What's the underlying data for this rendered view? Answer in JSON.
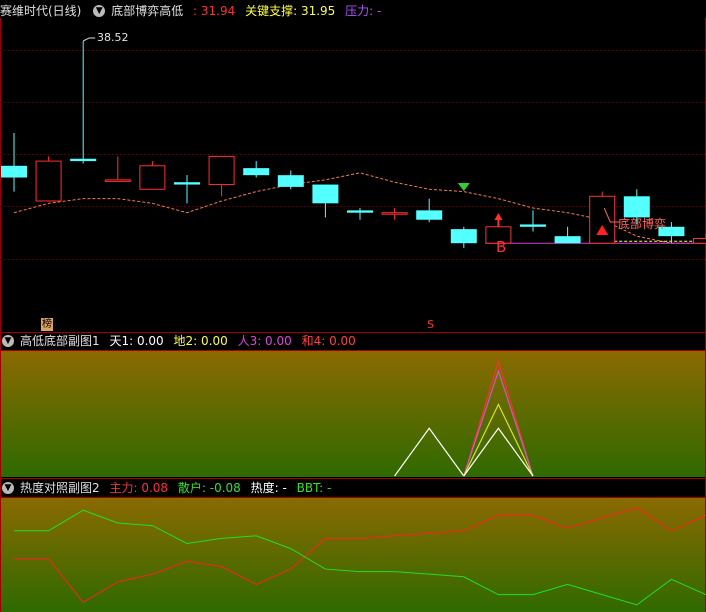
{
  "main_header": {
    "stock_name": "赛维时代(日线)",
    "indicator_name": "底部博弈高低",
    "value1": ": 31.94",
    "key_support_label": "关键支撑",
    "key_support_value": ": 31.95",
    "pressure_label": "压力",
    "pressure_value": ": -"
  },
  "sub1_header": {
    "name": "高低底部副图1",
    "tian": "天1: 0.00",
    "di": "地2: 0.00",
    "ren": "人3: 0.00",
    "he": "和4: 0.00"
  },
  "sub2_header": {
    "name": "热度对照副图2",
    "main_force": "主力: 0.08",
    "retail": "散户: -0.08",
    "heat": "热度: -",
    "bbt": "BBT: -"
  },
  "annotations": {
    "high_label": "38.52",
    "b_label": "B",
    "bottom_game_label": "底部博弈",
    "rank_marker": "榜",
    "s_marker": "S"
  },
  "colors": {
    "up": "#ff3030",
    "down": "#54ffff",
    "ma": "#ff7a3a",
    "support": "#d040d0",
    "main_force": "#ff2020",
    "retail": "#20e020"
  },
  "chart_data": [
    {
      "type": "candlestick",
      "title": "底部博弈高低",
      "candles": [
        {
          "o": 33.2,
          "h": 34.6,
          "l": 32.1,
          "c": 32.7,
          "dir": "down"
        },
        {
          "o": 31.7,
          "h": 33.6,
          "l": 31.7,
          "c": 33.4,
          "dir": "up"
        },
        {
          "o": 33.5,
          "h": 38.52,
          "l": 33.3,
          "c": 33.4,
          "dir": "down"
        },
        {
          "o": 32.6,
          "h": 33.6,
          "l": 32.6,
          "c": 32.6,
          "dir": "up"
        },
        {
          "o": 32.2,
          "h": 33.4,
          "l": 32.2,
          "c": 33.2,
          "dir": "up"
        },
        {
          "o": 32.5,
          "h": 32.8,
          "l": 31.6,
          "c": 32.4,
          "dir": "down"
        },
        {
          "o": 32.4,
          "h": 33.6,
          "l": 31.9,
          "c": 33.6,
          "dir": "up"
        },
        {
          "o": 33.1,
          "h": 33.4,
          "l": 32.7,
          "c": 32.8,
          "dir": "down"
        },
        {
          "o": 32.8,
          "h": 33.0,
          "l": 32.2,
          "c": 32.3,
          "dir": "down"
        },
        {
          "o": 32.4,
          "h": 32.4,
          "l": 31.0,
          "c": 31.6,
          "dir": "down"
        },
        {
          "o": 31.3,
          "h": 31.4,
          "l": 30.9,
          "c": 31.2,
          "dir": "down"
        },
        {
          "o": 31.2,
          "h": 31.4,
          "l": 30.9,
          "c": 31.2,
          "dir": "up"
        },
        {
          "o": 31.3,
          "h": 31.8,
          "l": 30.8,
          "c": 30.9,
          "dir": "down"
        },
        {
          "o": 30.5,
          "h": 30.6,
          "l": 29.7,
          "c": 29.9,
          "dir": "down"
        },
        {
          "o": 29.9,
          "h": 31.0,
          "l": 29.9,
          "c": 30.6,
          "dir": "up"
        },
        {
          "o": 30.7,
          "h": 31.3,
          "l": 30.4,
          "c": 30.6,
          "dir": "down"
        },
        {
          "o": 30.2,
          "h": 30.6,
          "l": 29.9,
          "c": 29.9,
          "dir": "down"
        },
        {
          "o": 29.9,
          "h": 32.1,
          "l": 29.9,
          "c": 31.9,
          "dir": "up"
        },
        {
          "o": 31.9,
          "h": 32.2,
          "l": 30.7,
          "c": 31.0,
          "dir": "down"
        },
        {
          "o": 30.6,
          "h": 30.8,
          "l": 29.9,
          "c": 30.2,
          "dir": "down"
        },
        {
          "o": 29.9,
          "h": 30.3,
          "l": 29.9,
          "c": 30.1,
          "dir": "up"
        }
      ],
      "ma": [
        31.2,
        31.6,
        31.8,
        31.8,
        31.6,
        31.2,
        31.7,
        32.1,
        32.4,
        32.6,
        32.9,
        32.5,
        32.2,
        32.1,
        31.8,
        31.4,
        31.2,
        30.9,
        30.2,
        29.9,
        29.9
      ],
      "ylim": [
        26.2,
        39.5
      ]
    },
    {
      "type": "area",
      "title": "高低底部副图1",
      "x": [
        11,
        12,
        13,
        14,
        15
      ],
      "series": [
        {
          "values": [
            0,
            1,
            0,
            null,
            null
          ],
          "color": "#ffffff"
        },
        {
          "values": [
            null,
            null,
            0,
            2.4,
            0
          ],
          "color": "#ff3030"
        },
        {
          "values": [
            null,
            null,
            0,
            2.2,
            0
          ],
          "color": "#c060c0"
        },
        {
          "values": [
            null,
            null,
            0,
            1.5,
            0
          ],
          "color": "#e0e020"
        },
        {
          "values": [
            null,
            null,
            0,
            1.0,
            0
          ],
          "color": "#ffffff"
        }
      ],
      "ylim": [
        0,
        2.6
      ]
    },
    {
      "type": "line",
      "title": "热度对照副图2",
      "series": [
        {
          "name": "主力",
          "values": [
            0.05,
            0.05,
            -0.12,
            -0.04,
            -0.01,
            0.04,
            0.02,
            -0.05,
            0.01,
            0.13,
            0.13,
            0.14,
            0.15,
            0.16,
            0.22,
            0.22,
            0.17,
            0.21,
            0.25,
            0.16,
            0.22,
            0.22
          ],
          "color": "#ff2020"
        },
        {
          "name": "散户",
          "values": [
            0.16,
            0.16,
            0.24,
            0.19,
            0.18,
            0.11,
            0.13,
            0.14,
            0.09,
            0.01,
            0.0,
            0.0,
            -0.01,
            -0.02,
            -0.09,
            -0.09,
            -0.05,
            -0.09,
            -0.13,
            -0.03,
            -0.09,
            -0.09
          ],
          "color": "#20e020"
        }
      ],
      "ylim": [
        -0.15,
        0.28
      ]
    }
  ]
}
